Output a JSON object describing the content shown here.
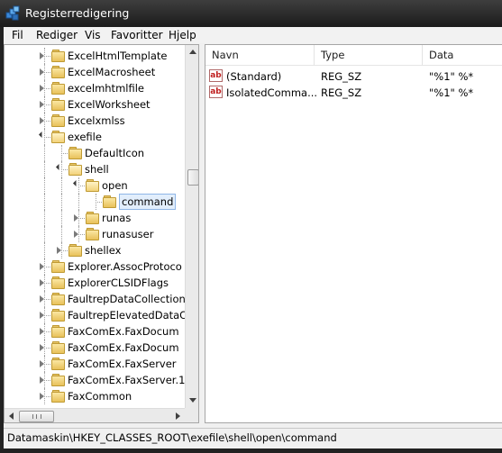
{
  "window": {
    "title": "Registerredigering",
    "icon": "registry-editor-icon"
  },
  "menu": [
    "Fil",
    "Rediger",
    "Vis",
    "Favoritter",
    "Hjelp"
  ],
  "tree": [
    {
      "label": "ExcelHtmlTemplate",
      "level": 0,
      "state": "collapsed",
      "selected": false
    },
    {
      "label": "ExcelMacrosheet",
      "level": 0,
      "state": "collapsed",
      "selected": false
    },
    {
      "label": "excelmhtmlfile",
      "level": 0,
      "state": "collapsed",
      "selected": false
    },
    {
      "label": "ExcelWorksheet",
      "level": 0,
      "state": "collapsed",
      "selected": false
    },
    {
      "label": "Excelxmlss",
      "level": 0,
      "state": "collapsed",
      "selected": false
    },
    {
      "label": "exefile",
      "level": 0,
      "state": "expanded",
      "selected": false
    },
    {
      "label": "DefaultIcon",
      "level": 1,
      "state": "none",
      "selected": false
    },
    {
      "label": "shell",
      "level": 1,
      "state": "expanded",
      "selected": false
    },
    {
      "label": "open",
      "level": 2,
      "state": "expanded",
      "selected": false
    },
    {
      "label": "command",
      "level": 3,
      "state": "none",
      "selected": true
    },
    {
      "label": "runas",
      "level": 2,
      "state": "collapsed",
      "selected": false
    },
    {
      "label": "runasuser",
      "level": 2,
      "state": "collapsed",
      "selected": false
    },
    {
      "label": "shellex",
      "level": 1,
      "state": "collapsed",
      "selected": false
    },
    {
      "label": "Explorer.AssocProtoco",
      "level": 0,
      "state": "collapsed",
      "selected": false
    },
    {
      "label": "ExplorerCLSIDFlags",
      "level": 0,
      "state": "collapsed",
      "selected": false
    },
    {
      "label": "FaultrepDataCollection",
      "level": 0,
      "state": "collapsed",
      "selected": false
    },
    {
      "label": "FaultrepElevatedDataC",
      "level": 0,
      "state": "collapsed",
      "selected": false
    },
    {
      "label": "FaxComEx.FaxDocum",
      "level": 0,
      "state": "collapsed",
      "selected": false
    },
    {
      "label": "FaxComEx.FaxDocum",
      "level": 0,
      "state": "collapsed",
      "selected": false
    },
    {
      "label": "FaxComEx.FaxServer",
      "level": 0,
      "state": "collapsed",
      "selected": false
    },
    {
      "label": "FaxComEx.FaxServer.1",
      "level": 0,
      "state": "collapsed",
      "selected": false
    },
    {
      "label": "FaxCommon",
      "level": 0,
      "state": "collapsed",
      "selected": false
    }
  ],
  "list": {
    "columns": [
      "Navn",
      "Type",
      "Data"
    ],
    "rows": [
      {
        "icon": "string-value-icon",
        "name": "(Standard)",
        "type": "REG_SZ",
        "data": "\"%1\" %*"
      },
      {
        "icon": "string-value-icon",
        "name": "IsolatedComma...",
        "type": "REG_SZ",
        "data": "\"%1\" %*"
      }
    ]
  },
  "status": "Datamaskin\\HKEY_CLASSES_ROOT\\exefile\\shell\\open\\command"
}
